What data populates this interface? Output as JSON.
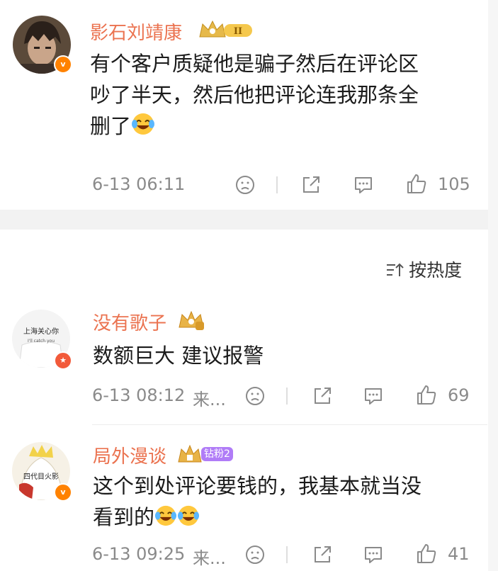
{
  "post": {
    "username": "影石刘靖康",
    "level_badge": "II",
    "text_line1": "有个客户质疑他是骗子然后在评论区",
    "text_line2": "吵了半天，然后他把评论连我那条全",
    "text_line3": "删了",
    "timestamp": "6-13 06:11",
    "likes": "105"
  },
  "sort": {
    "label": "按热度"
  },
  "comments": [
    {
      "username": "没有歌子",
      "text": "数额巨大 建议报警",
      "timestamp": "6-13 08:12",
      "source": "来...",
      "likes": "69",
      "avatar_text_1": "上海关心你",
      "avatar_text_2": "I'll catch you"
    },
    {
      "username": "局外漫谈",
      "fans_badge": "钻粉2",
      "text_line1": "这个到处评论要钱的，我基本就当没",
      "text_line2": "看到的",
      "timestamp": "6-13 09:25",
      "source": "来...",
      "likes": "41",
      "avatar_text": "四代目火影"
    }
  ],
  "colors": {
    "username": "#eb7350",
    "verified": "#ff8200",
    "meta": "#8a8a8a",
    "fans": "#b07cf7"
  }
}
